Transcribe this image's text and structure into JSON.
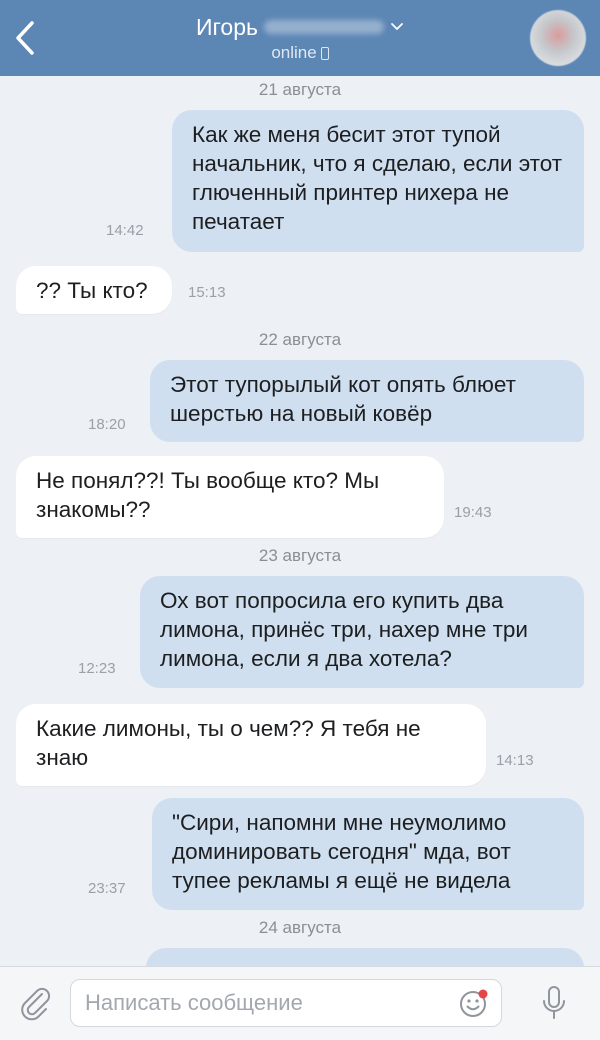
{
  "header": {
    "contact_name": "Игорь",
    "status": "online",
    "colors": {
      "bar": "#5c86b4",
      "text": "#ffffff"
    }
  },
  "messages": [
    {
      "kind": "date",
      "text": "21 августа"
    },
    {
      "kind": "out",
      "text": "Как же меня бесит этот тупой начальник, что я сделаю, если этот глюченный принтер нихера не печатает",
      "time": "14:42"
    },
    {
      "kind": "in",
      "text": "?? Ты кто?",
      "time": "15:13"
    },
    {
      "kind": "date",
      "text": "22 августа"
    },
    {
      "kind": "out",
      "text": "Этот тупорылый кот опять блюет шерстью на новый ковёр",
      "time": "18:20"
    },
    {
      "kind": "in",
      "text": "Не понял??! Ты вообще кто? Мы знакомы??",
      "time": "19:43"
    },
    {
      "kind": "date",
      "text": "23 августа"
    },
    {
      "kind": "out",
      "text": "Ох вот попросила его купить два лимона, принёс три, нахер мне три лимона, если я два хотела?",
      "time": "12:23"
    },
    {
      "kind": "in",
      "text": "Какие лимоны, ты о чем?? Я тебя не знаю",
      "time": "14:13"
    },
    {
      "kind": "out",
      "text": "\"Сири, напомни мне неумолимо доминировать сегодня\" мда, вот тупее рекламы я ещё не видела",
      "time": "23:37"
    },
    {
      "kind": "date",
      "text": "24 августа"
    }
  ],
  "composer": {
    "placeholder": "Написать сообщение"
  },
  "icons": {
    "back": "chevron-left-icon",
    "dropdown": "chevron-down-icon",
    "device": "phone-icon",
    "attach": "paperclip-icon",
    "emoji": "smiley-icon",
    "voice": "microphone-icon"
  },
  "colors": {
    "outgoing_bubble": "#cfdff0",
    "incoming_bubble": "#ffffff",
    "background": "#edf0f4",
    "timestamp": "#9aa0a8"
  }
}
